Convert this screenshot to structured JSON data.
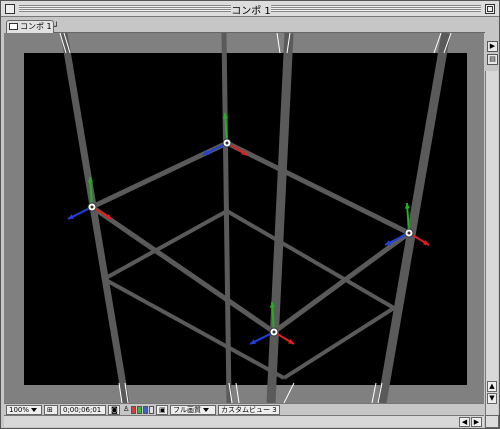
{
  "window": {
    "title": "コンポ 1"
  },
  "tab": {
    "label": "コンポ 1 ┘"
  },
  "toolbar": {
    "zoom": "100%",
    "timecode": "0;00;06;01",
    "quality": "フル画質",
    "view": "カスタムビュー 3"
  },
  "scene": {
    "background": "#000000",
    "beam_color": "#5a5a5a",
    "axis_colors": {
      "x": "#e02020",
      "y": "#20b020",
      "z": "#2040e0"
    }
  },
  "scrollbar": {
    "up": "▲",
    "down": "▼",
    "left": "◀",
    "right": "▶"
  },
  "sidebar": {
    "btn1": "▶",
    "btn2": "▤"
  }
}
